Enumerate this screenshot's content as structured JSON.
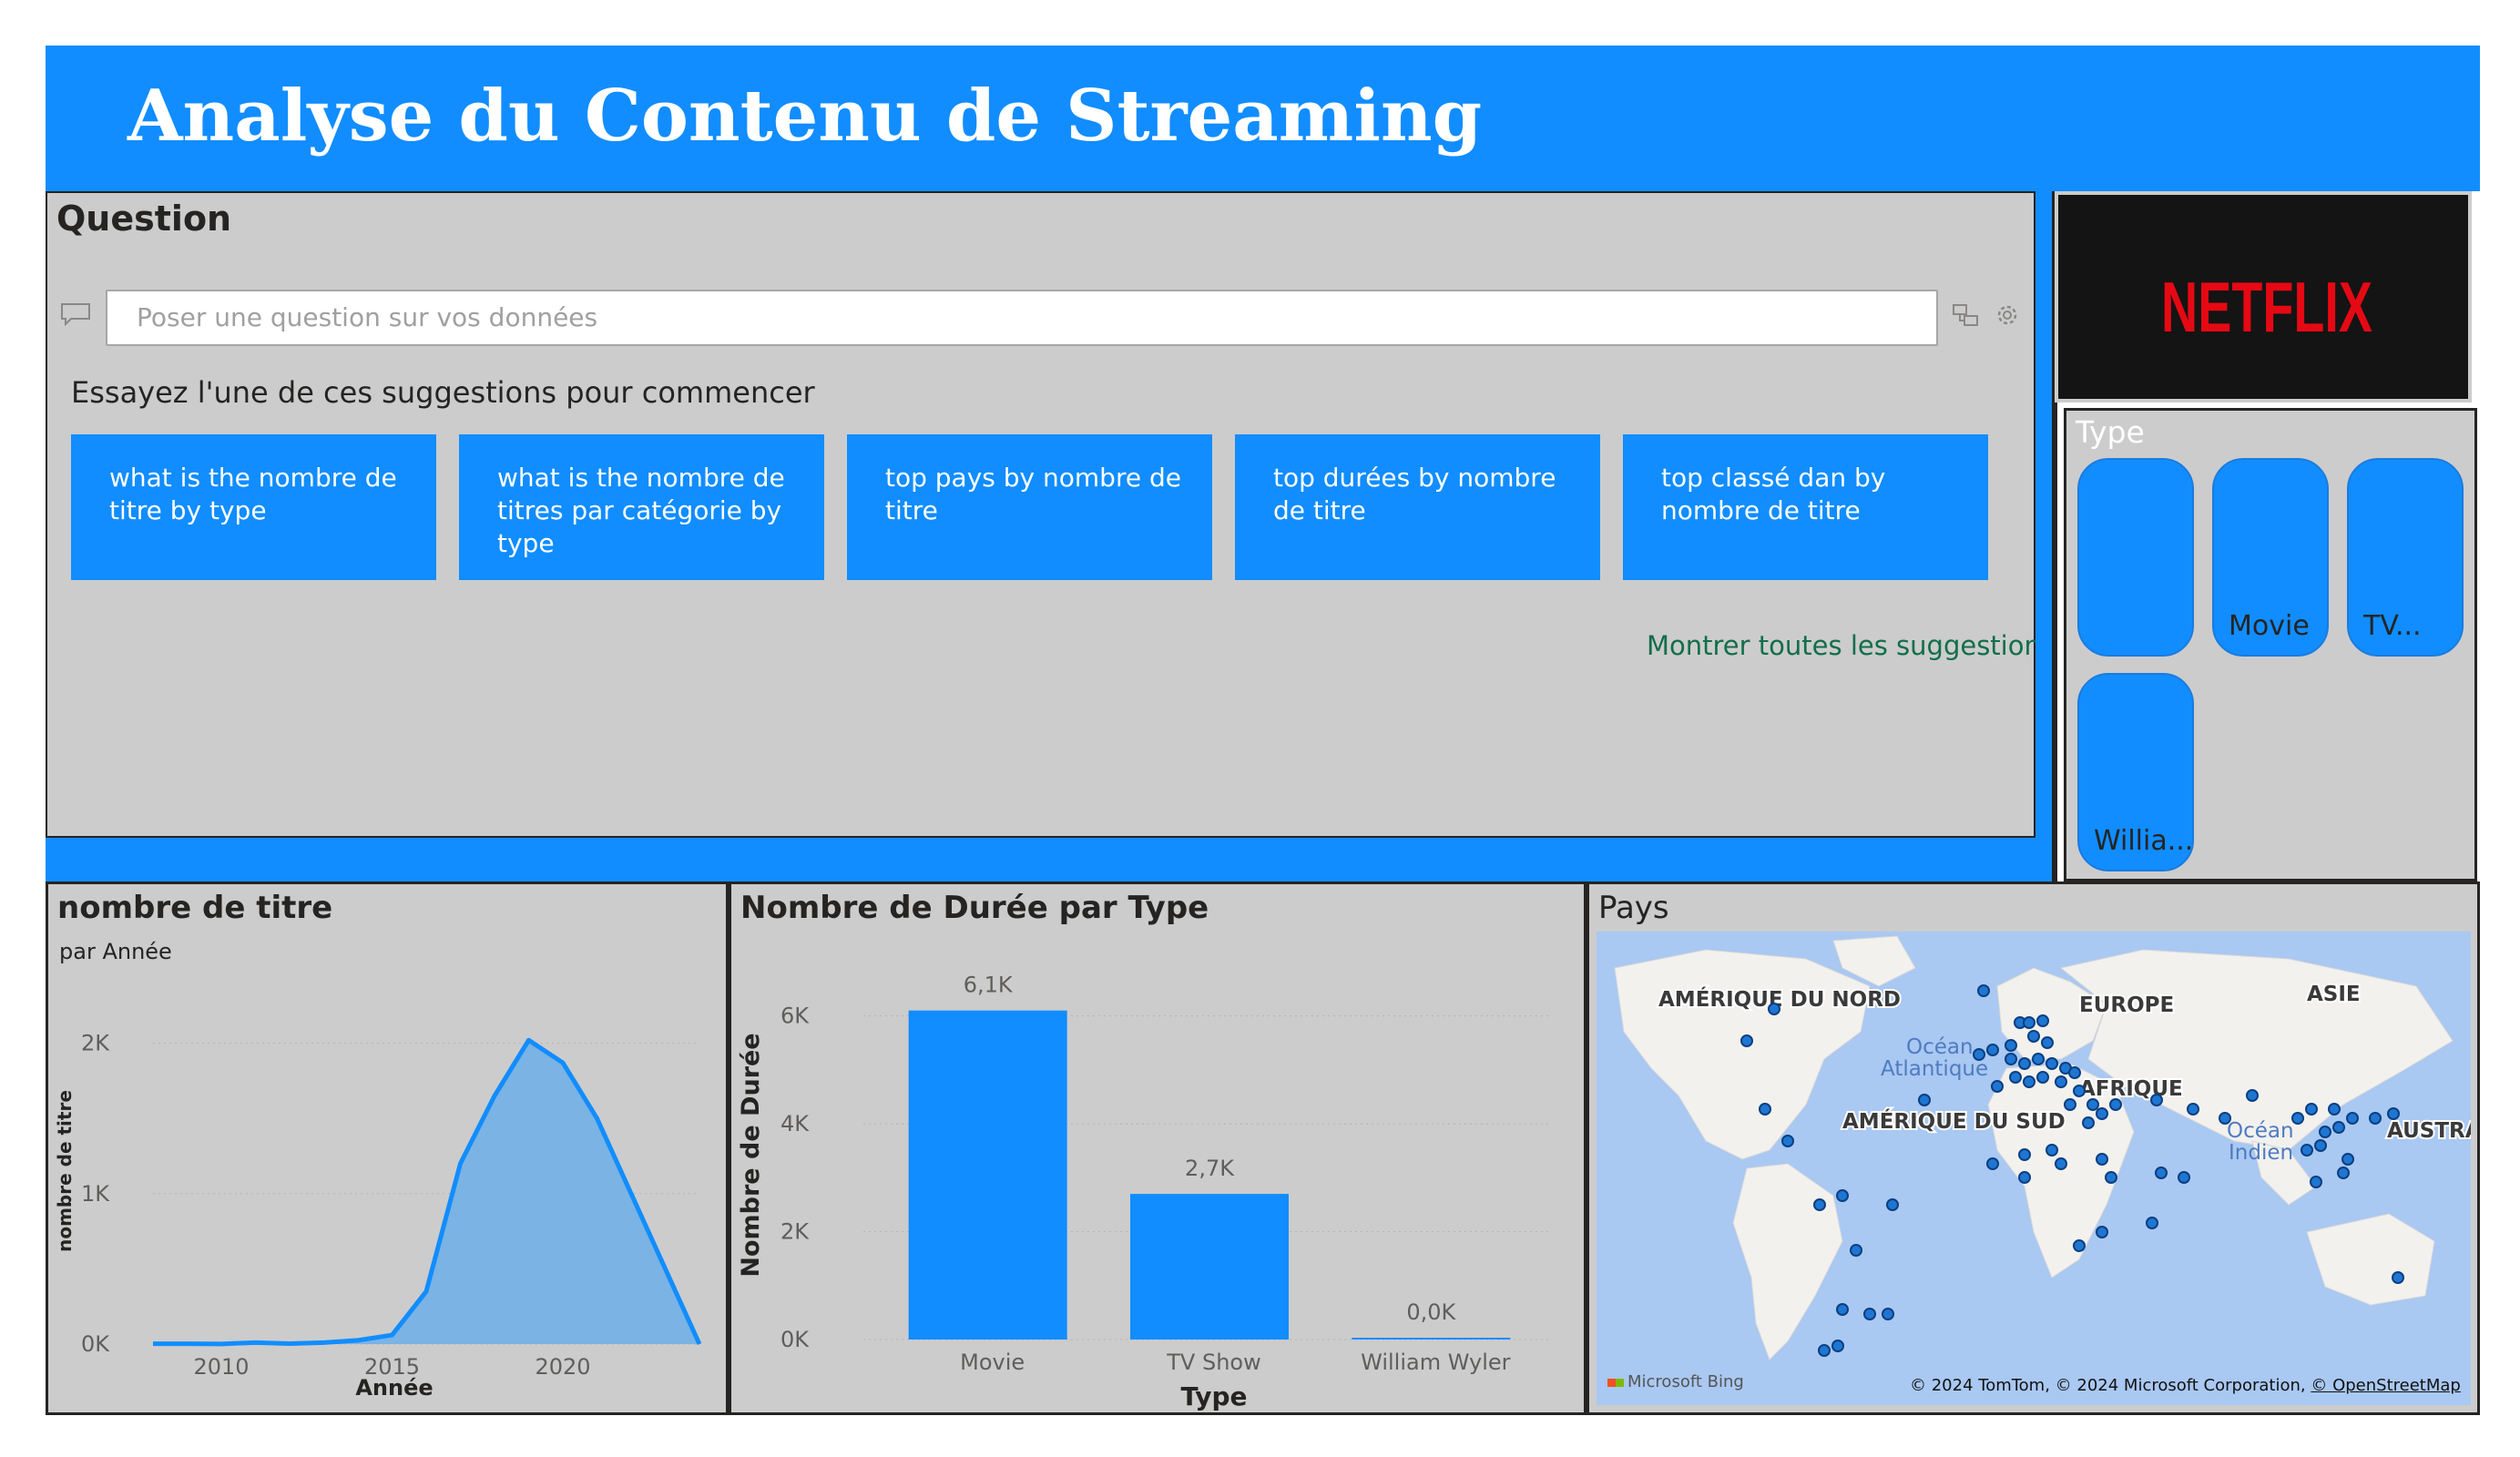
{
  "header": {
    "title": "Analyse du Contenu de Streaming"
  },
  "colors": {
    "accent": "#118dff",
    "panel_bg": "#cccccc",
    "border": "#252423",
    "link": "#126e4c",
    "netflix_red": "#e50914"
  },
  "qa": {
    "title": "Question",
    "placeholder": "Poser une question sur vos données",
    "prompt": "Essayez l'une de ces suggestions pour commencer",
    "suggestions": [
      "what is the nombre de titre by type",
      "what is the nombre de titres par catégorie by type",
      "top pays by nombre de titre",
      "top durées by nombre de titre",
      "top classé dan by nombre de titre"
    ],
    "show_all": "Montrer toutes les suggestions",
    "icons": [
      "chat-icon",
      "share-icon",
      "gear-icon"
    ]
  },
  "logo": {
    "text": "NETFLIX"
  },
  "type_slicer": {
    "title": "Type",
    "tiles": [
      "",
      "Movie",
      "TV...",
      "Willia..."
    ]
  },
  "line_panel": {
    "title": "nombre de titre",
    "subtitle": "par Année"
  },
  "bar_panel": {
    "title": "Nombre de Durée par Type"
  },
  "map_panel": {
    "title": "Pays",
    "labels": {
      "north_america": "AMÉRIQUE DU NORD",
      "europe": "EUROPE",
      "asia": "ASIE",
      "africa": "AFRIQUE",
      "south_america": "AMÉRIQUE DU SUD",
      "australia": "AUSTRA",
      "atlantic_1": "Océan",
      "atlantic_2": "Atlantique",
      "indian_1": "Océan",
      "indian_2": "Indien"
    },
    "attribution": "© 2024 TomTom, © 2024 Microsoft Corporation,",
    "attribution_link": "© OpenStreetMap",
    "bing": "Microsoft Bing"
  },
  "chart_data": [
    {
      "type": "area",
      "title": "nombre de titre",
      "subtitle": "par Année",
      "xlabel": "Année",
      "ylabel": "nombre de titre",
      "x": [
        2008,
        2009,
        2010,
        2011,
        2012,
        2013,
        2014,
        2015,
        2016,
        2017,
        2018,
        2019,
        2020,
        2021,
        2022,
        2023,
        2024
      ],
      "y": [
        2,
        2,
        1,
        10,
        3,
        10,
        25,
        60,
        350,
        1200,
        1650,
        2020,
        1870,
        1500,
        1000,
        500,
        0
      ],
      "xticks": [
        "2010",
        "2015",
        "2020"
      ],
      "yticks": [
        "0K",
        "1K",
        "2K"
      ],
      "ylim": [
        0,
        2300
      ],
      "xlim": [
        2008,
        2024
      ],
      "grid": true
    },
    {
      "type": "bar",
      "title": "Nombre de Durée par Type",
      "xlabel": "Type",
      "ylabel": "Nombre de Durée",
      "categories": [
        "Movie",
        "TV Show",
        "William Wyler"
      ],
      "values": [
        6100,
        2700,
        0
      ],
      "data_labels": [
        "6,1K",
        "2,7K",
        "0,0K"
      ],
      "yticks": [
        "0K",
        "2K",
        "4K",
        "6K"
      ],
      "ylim": [
        0,
        6500
      ],
      "grid": true
    }
  ]
}
